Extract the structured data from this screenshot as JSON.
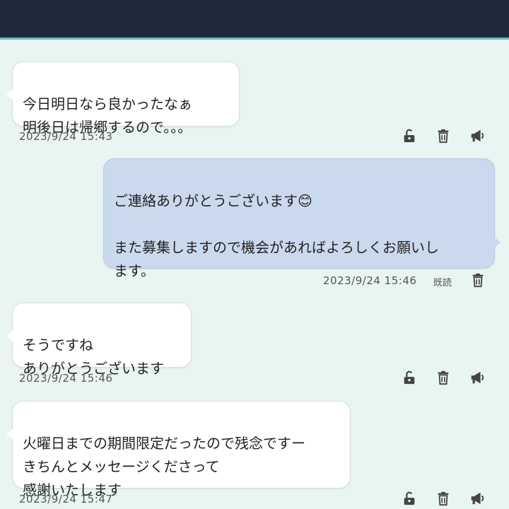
{
  "messages": [
    {
      "direction": "in",
      "text": "今日明日なら良かったなぁ\n明後日は帰郷するので。。。",
      "timestamp": "2023/9/24 15:43",
      "actions": [
        "unlock-icon",
        "trash-icon",
        "megaphone-icon"
      ]
    },
    {
      "direction": "out",
      "text": "ご連絡ありがとうございます😊\n\nまた募集しますので機会があればよろしくお願いし\nます。",
      "timestamp": "2023/9/24 15:46",
      "read_label": "既読",
      "actions": [
        "trash-icon"
      ]
    },
    {
      "direction": "in",
      "text": "そうですね\nありがとうございます",
      "timestamp": "2023/9/24 15:46",
      "actions": [
        "unlock-icon",
        "trash-icon",
        "megaphone-icon"
      ]
    },
    {
      "direction": "in",
      "text": "火曜日までの期間限定だったので残念ですー\nきちんとメッセージくださって\n感謝いたします",
      "timestamp": "2023/9/24 15:47",
      "actions": [
        "unlock-icon",
        "trash-icon",
        "megaphone-icon"
      ]
    }
  ],
  "colors": {
    "background": "#e8f5f3",
    "header": "#1f2a3a",
    "outgoing_bubble": "#cbd9ee",
    "incoming_bubble": "#ffffff"
  }
}
